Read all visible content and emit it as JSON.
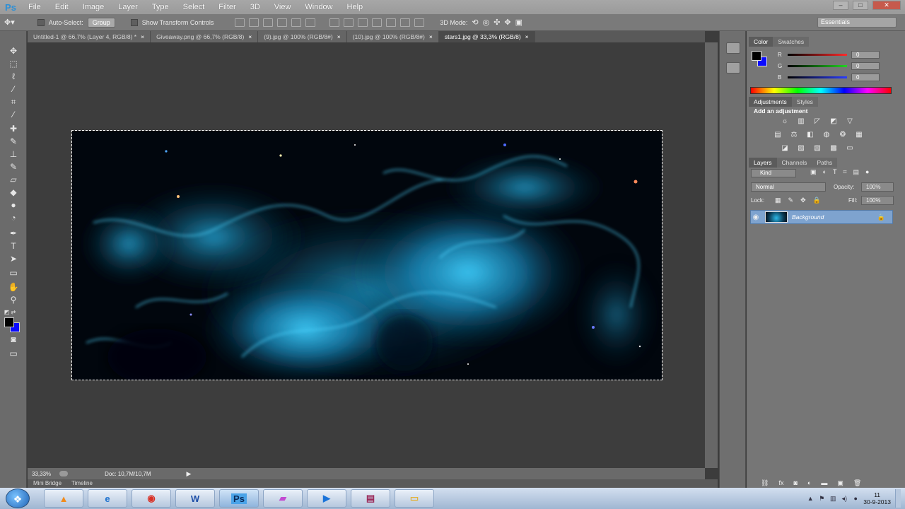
{
  "app": {
    "logo": "Ps"
  },
  "menu": [
    "File",
    "Edit",
    "Image",
    "Layer",
    "Type",
    "Select",
    "Filter",
    "3D",
    "View",
    "Window",
    "Help"
  ],
  "window_controls": [
    "–",
    "□",
    "✕"
  ],
  "options_bar": {
    "auto_select_label": "Auto-Select:",
    "auto_select_value": "Group",
    "show_transform_label": "Show Transform Controls",
    "mode_3d_label": "3D Mode:",
    "workspace_value": "Essentials"
  },
  "tabs": [
    {
      "title": "Untitled-1 @ 66,7% (Layer 4, RGB/8) *",
      "active": false
    },
    {
      "title": "Giveaway.png @ 66,7% (RGB/8)",
      "active": false
    },
    {
      "title": "(9).jpg @ 100% (RGB/8#)",
      "active": false
    },
    {
      "title": "(10).jpg @ 100% (RGB/8#)",
      "active": false
    },
    {
      "title": "stars1.jpg @ 33,3% (RGB/8)",
      "active": true
    }
  ],
  "status": {
    "zoom": "33,33%",
    "doc": "Doc: 10,7M/10,7M"
  },
  "bottom_tabs": [
    "Mini Bridge",
    "Timeline"
  ],
  "color_panel": {
    "tabs": [
      "Color",
      "Swatches"
    ],
    "channels": [
      {
        "label": "R",
        "value": "0",
        "color": "#ff2a2a"
      },
      {
        "label": "G",
        "value": "0",
        "color": "#22d422"
      },
      {
        "label": "B",
        "value": "0",
        "color": "#2a3cff"
      }
    ],
    "foreground": "#000000",
    "background": "#0a0aff"
  },
  "adjustments_panel": {
    "tabs": [
      "Adjustments",
      "Styles"
    ],
    "heading": "Add an adjustment"
  },
  "layers_panel": {
    "tabs": [
      "Layers",
      "Channels",
      "Paths"
    ],
    "kind_value": "Kind",
    "blend_mode": "Normal",
    "opacity_label": "Opacity:",
    "opacity_value": "100%",
    "lock_label": "Lock:",
    "fill_label": "Fill:",
    "fill_value": "100%",
    "layers": [
      {
        "name": "Background",
        "visible": true
      }
    ]
  },
  "taskbar": {
    "apps": [
      "start",
      "vlc",
      "ie",
      "chrome",
      "word",
      "photoshop",
      "paint",
      "media",
      "winrar",
      "explorer"
    ],
    "clock_time": "11",
    "clock_date": "30-9-2013"
  }
}
